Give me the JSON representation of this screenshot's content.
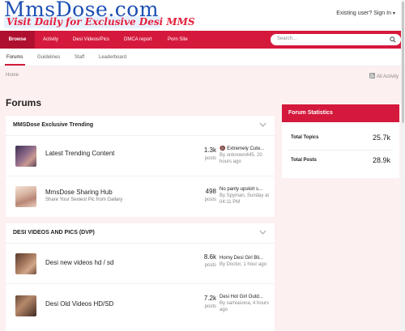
{
  "header": {
    "logo_main": "MmsDose.com",
    "logo_tagline": "Visit Daily for Exclusive Desi MMS",
    "signin": "Existing user? Sign In",
    "signin_caret": "▾"
  },
  "nav": {
    "items": [
      "Browse",
      "Activity",
      "Desi Videos/Pics",
      "DMCA report",
      "Porn Site"
    ],
    "search_placeholder": "Search..."
  },
  "subnav": {
    "items": [
      "Forums",
      "Guidelines",
      "Staff",
      "Leaderboard"
    ]
  },
  "breadcrumb": {
    "home": "Home",
    "all_activity": "All Activity"
  },
  "page_title": "Forums",
  "sections": [
    {
      "title": "MMSDose Exclusive Trending",
      "rows": [
        {
          "title": "Latest Trending Content",
          "description": "",
          "count": "1.3k",
          "count_label": "posts",
          "last_title": "🔞 Extremely Cute...",
          "last_meta": "By unknown445, 20 hours ago"
        },
        {
          "title": "MmsDose Sharing Hub",
          "description": "Share Your Sexiest Pic from Gallary",
          "count": "498",
          "count_label": "posts",
          "last_title": "No panty upskirt s...",
          "last_meta": "By Spyman, Sunday at 04:11 PM"
        }
      ]
    },
    {
      "title": "DESI VIDEOS AND PICS (DVP)",
      "rows": [
        {
          "title": "Desi new videos hd / sd",
          "description": "",
          "count": "8.6k",
          "count_label": "posts",
          "last_title": "Horny Desi Girl Bli...",
          "last_meta": "By Doctor, 1 hour ago"
        },
        {
          "title": "Desi Old Videos HD/SD",
          "description": "",
          "count": "7.2k",
          "count_label": "posts",
          "last_title": "Desi Hot Girl Outd...",
          "last_meta": "By samiasona, 4 hours ago"
        }
      ]
    }
  ],
  "stats": {
    "title": "Forum Statistics",
    "total_topics_label": "Total Topics",
    "total_topics": "25.7k",
    "total_posts_label": "Total Posts",
    "total_posts": "28.9k"
  },
  "colors": {
    "brand_red": "#d5193c",
    "logo_blue": "#1c4fb3",
    "page_bg": "#fdf0f0"
  }
}
